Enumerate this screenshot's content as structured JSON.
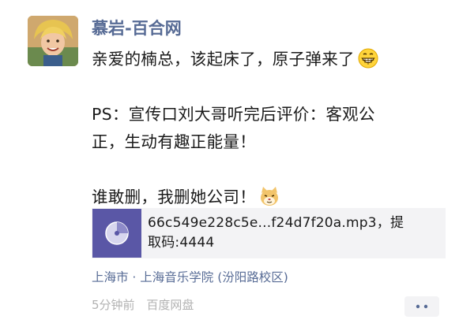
{
  "post": {
    "author": "慕岩-百合网",
    "lines": [
      "亲爱的楠总，该起床了，原子弹来了",
      "PS：宣传口刘大哥听完后评价：客观公",
      "正，生动有趣正能量！",
      "谁敢删，我删她公司！"
    ],
    "attachment_line1": "66c549e228c5e...f24d7f20a.mp3，提",
    "attachment_line2": "取码:4444",
    "location": "上海市 · 上海音乐学院 (汾阳路校区)",
    "time": "5分钟前",
    "source": "百度网盘"
  },
  "icons": {
    "avatar": "avatar-photo",
    "grin": "grinning-face-icon",
    "cat": "cat-face-icon",
    "music": "music-file-icon",
    "more": "more-dots-icon"
  },
  "colors": {
    "name_blue": "#576b95",
    "music_purple": "#5a57a6",
    "meta_gray": "#b2b2b2",
    "card_bg": "#f3f3f5"
  }
}
